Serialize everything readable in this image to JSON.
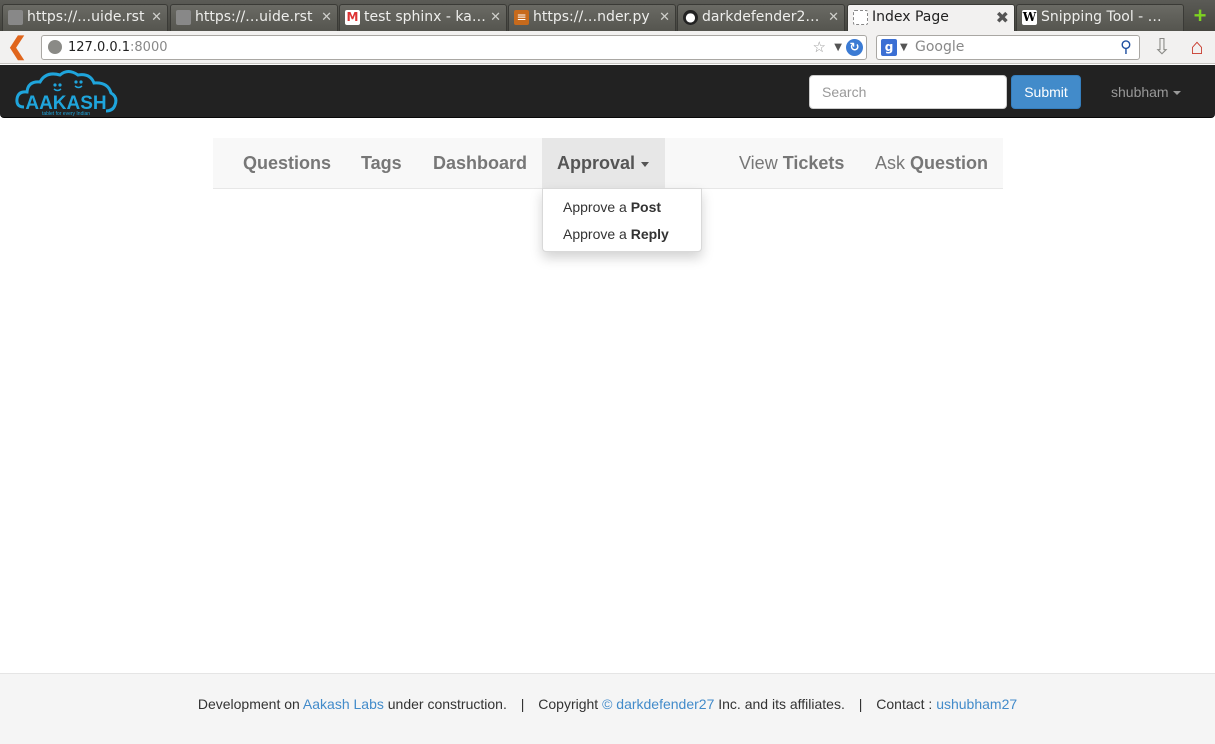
{
  "browser": {
    "tabs": [
      {
        "label": "https://…uide.rst",
        "icon": "file-icon",
        "active": false
      },
      {
        "label": "https://…uide.rst",
        "icon": "file-icon",
        "active": false
      },
      {
        "label": "test sphinx - ka…",
        "icon": "gmail-icon",
        "active": false
      },
      {
        "label": "https://…nder.py",
        "icon": "code-file-icon",
        "active": false
      },
      {
        "label": "darkdefender2…",
        "icon": "github-icon",
        "active": false
      },
      {
        "label": "Index Page",
        "icon": "blank-page-icon",
        "active": true
      },
      {
        "label": "Snipping Tool - …",
        "icon": "wikipedia-icon",
        "active": false
      }
    ],
    "url_host": "127.0.0.1",
    "url_port": ":8000",
    "search_engine_placeholder": "Google"
  },
  "navbar": {
    "logo_text": "AAKASH",
    "logo_tagline": "tablet for every Indian",
    "search_placeholder": "Search",
    "submit_label": "Submit",
    "user_label": "shubham"
  },
  "subnav": {
    "questions": "Questions",
    "tags": "Tags",
    "dashboard": "Dashboard",
    "approval": "Approval",
    "view_tickets_prefix": "View",
    "view_tickets_bold": "Tickets",
    "ask_question_prefix": "Ask",
    "ask_question_bold": "Question"
  },
  "approval_menu": {
    "post_prefix": "Approve a",
    "post_bold": "Post",
    "reply_prefix": "Approve a",
    "reply_bold": "Reply"
  },
  "footer": {
    "dev_prefix": "Development on",
    "dev_link": "Aakash Labs",
    "dev_suffix": "under construction.",
    "sep": "|",
    "copyright_prefix": "Copyright",
    "copyright_link": "© darkdefender27",
    "copyright_suffix": "Inc. and its affiliates.",
    "contact_prefix": "Contact :",
    "contact_link": "ushubham27"
  },
  "colors": {
    "navbar_bg": "#222222",
    "primary": "#428bca",
    "subnav_bg": "#f8f8f8",
    "footer_bg": "#f5f5f5",
    "logo_blue": "#1fa5dc"
  }
}
